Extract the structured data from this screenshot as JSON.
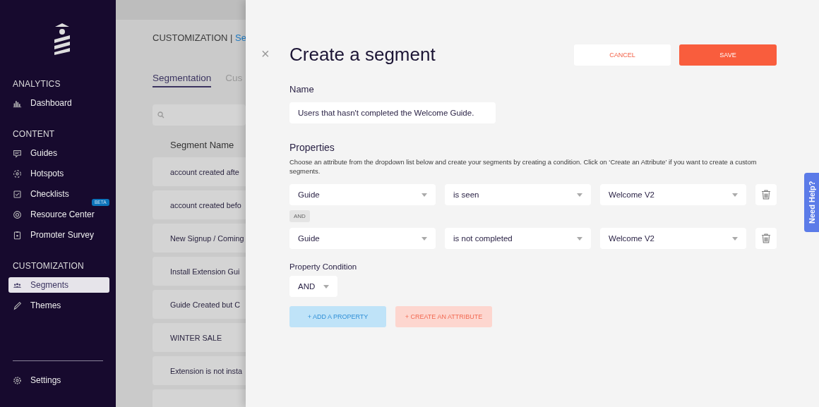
{
  "sidebar": {
    "sections": [
      {
        "heading": "ANALYTICS",
        "items": [
          {
            "label": "Dashboard",
            "selected": false
          }
        ]
      },
      {
        "heading": "CONTENT",
        "items": [
          {
            "label": "Guides",
            "selected": false
          },
          {
            "label": "Hotspots",
            "selected": false
          },
          {
            "label": "Checklists",
            "selected": false
          },
          {
            "label": "Resource Center",
            "selected": false,
            "badge": "BETA"
          },
          {
            "label": "Promoter Survey",
            "selected": false
          }
        ]
      },
      {
        "heading": "CUSTOMIZATION",
        "items": [
          {
            "label": "Segments",
            "selected": true
          },
          {
            "label": "Themes",
            "selected": false
          }
        ]
      }
    ],
    "footer_items": [
      {
        "label": "Settings",
        "selected": false
      }
    ]
  },
  "background_page": {
    "breadcrumb": "CUSTOMIZATION |",
    "breadcrumb_link": "Se",
    "tabs": [
      {
        "label": "Segmentation",
        "selected": true
      },
      {
        "label": "Cus",
        "selected": false
      }
    ],
    "column_header": "Segment Name",
    "rows": [
      "account created afte",
      "account created befo",
      "New Signup / Coming",
      "Install Extension Gui",
      "Guide Created but C",
      "WINTER SALE",
      "Extension is not insta"
    ]
  },
  "modal": {
    "close": "×",
    "title": "Create a segment",
    "cancel_button": "CANCEL",
    "save_button": "SAVE",
    "name_label": "Name",
    "name_value": "Users that hasn't completed the Welcome Guide.",
    "properties_heading": "Properties",
    "properties_description": "Choose an attribute from the dropdown list below and create your segments by creating a condition. Click on ‘Create an Attribute’ if you want to create a custom segments.",
    "conditions": [
      {
        "attribute": "Guide",
        "operator": "is seen",
        "value": "Welcome V2"
      },
      {
        "joiner": "AND",
        "attribute": "Guide",
        "operator": "is not completed",
        "value": "Welcome V2"
      }
    ],
    "condition_label": "Property Condition",
    "condition_value": "AND",
    "add_property_button": "+ ADD A PROPERTY",
    "create_attribute_button": "+ CREATE AN ATTRIBUTE"
  },
  "help_tab": "Need Help?"
}
